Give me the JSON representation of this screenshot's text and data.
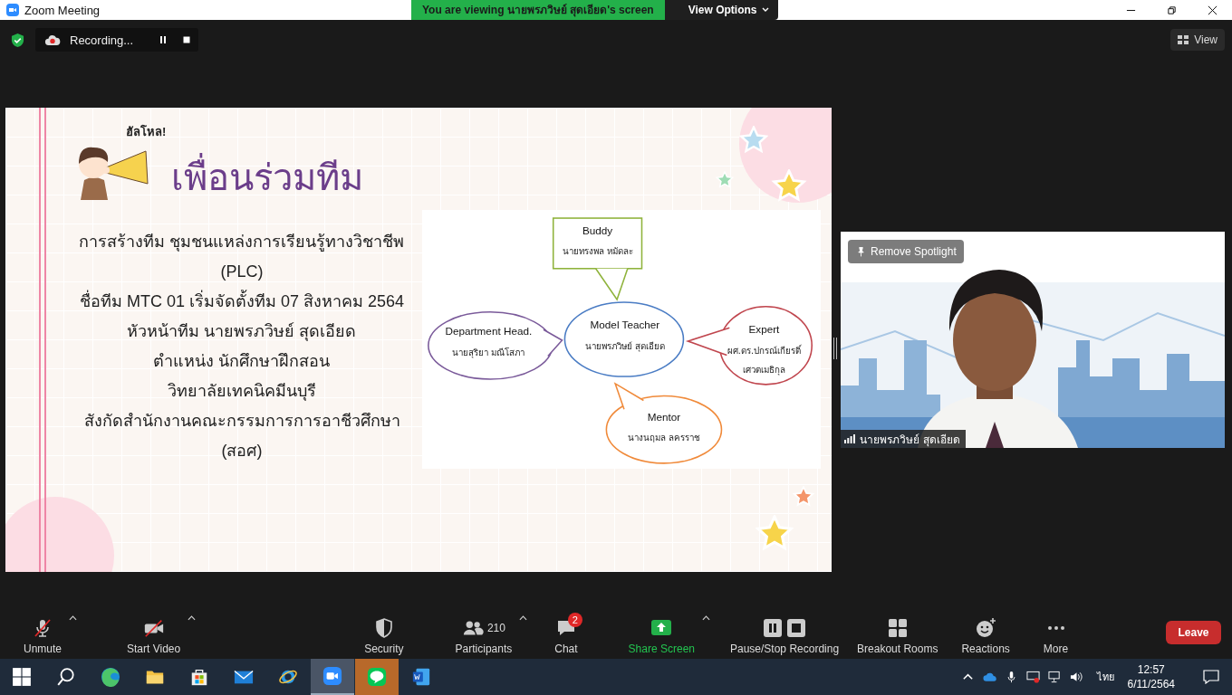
{
  "window": {
    "title": "Zoom Meeting"
  },
  "share_banner": {
    "text": "You are viewing นายพรภวิษย์ สุดเอียด's screen",
    "view_options": "View Options"
  },
  "recording": {
    "label": "Recording..."
  },
  "view_button": {
    "label": "View"
  },
  "slide": {
    "exclamation": "ฮัลโหล!",
    "title": "เพื่อนร่วมทีม",
    "lines": [
      "การสร้างทีม ชุมชนแหล่งการเรียนรู้ทางวิชาชีพ",
      "(PLC)",
      "ชื่อทีม MTC 01 เริ่มจัดตั้งทีม 07 สิงหาคม 2564",
      "หัวหน้าทีม นายพรภวิษย์ สุดเอียด",
      "ตำแหน่ง นักศึกษาฝึกสอน",
      "วิทยาลัยเทคนิคมีนบุรี",
      "สังกัดสำนักงานคณะกรรมการการอาชีวศึกษา",
      "(สอศ)"
    ],
    "diagram": {
      "center": {
        "role": "Model Teacher",
        "name_lines": [
          "นายพรภวิษย์ สุดเอียด"
        ],
        "color": "#4a7cc4"
      },
      "bubbles": [
        {
          "kind": "box",
          "role": "Buddy",
          "name_lines": [
            "นายทรงพล หมัดละ"
          ],
          "color": "#8fb33c"
        },
        {
          "kind": "oval",
          "role": "Department Head.",
          "name_lines": [
            "นายสุริยา มณีโสภา"
          ],
          "color": "#7a5a9a"
        },
        {
          "kind": "oval",
          "role": "Expert",
          "name_lines": [
            "ผศ.ดร.ปกรณ์เกียรติ์",
            "เศวตเมธิกุล"
          ],
          "color": "#c0464e"
        },
        {
          "kind": "oval",
          "role": "Mentor",
          "name_lines": [
            "นางนฤมล ลครราช"
          ],
          "color": "#f08a3a"
        }
      ]
    }
  },
  "video": {
    "spotlight": "Remove Spotlight",
    "participant": "นายพรภวิษย์ สุดเอียด"
  },
  "toolbar": [
    {
      "kind": "mic",
      "label": "Unmute",
      "off": true,
      "menu": true
    },
    {
      "kind": "camera",
      "label": "Start Video",
      "off": true,
      "menu": true
    },
    {
      "kind": "security",
      "label": "Security",
      "menu": false
    },
    {
      "kind": "participants",
      "label": "Participants",
      "count": "210",
      "menu": true
    },
    {
      "kind": "chat",
      "label": "Chat",
      "badge": "2",
      "menu": false
    },
    {
      "kind": "share",
      "label": "Share Screen",
      "menu": true
    },
    {
      "kind": "recording",
      "label": "Pause/Stop Recording",
      "menu": false
    },
    {
      "kind": "breakout",
      "label": "Breakout Rooms",
      "menu": false
    },
    {
      "kind": "reactions",
      "label": "Reactions",
      "menu": false
    },
    {
      "kind": "more",
      "label": "More",
      "menu": false
    }
  ],
  "leave": {
    "label": "Leave"
  },
  "taskbar": {
    "apps": [
      {
        "kind": "start",
        "active": false,
        "flashing": false
      },
      {
        "kind": "search",
        "active": false,
        "flashing": false
      },
      {
        "kind": "edge",
        "active": false,
        "flashing": false
      },
      {
        "kind": "explorer",
        "active": false,
        "flashing": false
      },
      {
        "kind": "store",
        "active": false,
        "flashing": false
      },
      {
        "kind": "mail",
        "active": false,
        "flashing": false
      },
      {
        "kind": "ie",
        "active": false,
        "flashing": false
      },
      {
        "kind": "zoom",
        "active": true,
        "flashing": false
      },
      {
        "kind": "line",
        "active": false,
        "flashing": true
      },
      {
        "kind": "word",
        "active": false,
        "flashing": false
      }
    ],
    "tray": {
      "language": "ไทย",
      "time": "12:57",
      "date": "6/11/2564"
    }
  }
}
